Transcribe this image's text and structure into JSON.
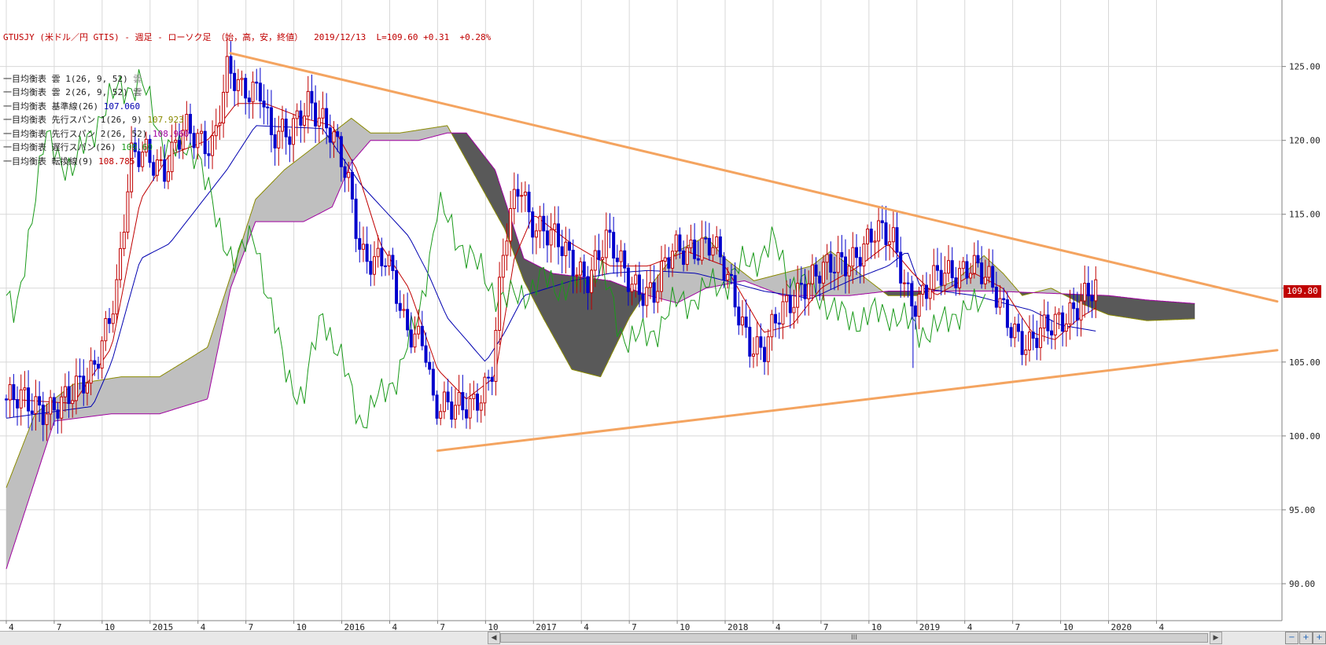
{
  "header": {
    "title": "GTUSJY (米ドル／円 GTIS) - 週足 - ローソク足 （始，高，安，終値）",
    "quote": "2019/12/13  L=109.60 +0.31  +0.28%"
  },
  "legend": [
    {
      "name": "一目均衡表 雲 1(26, 9, 52)",
      "value": "雲",
      "color": "#888888"
    },
    {
      "name": "一目均衡表 雲 2(26, 9, 52)",
      "value": "雲",
      "color": "#555555"
    },
    {
      "name": "一目均衡表 基準線(26)",
      "value": "107.060",
      "color": "#0000b0"
    },
    {
      "name": "一目均衡表 先行スパン 1(26, 9)",
      "value": "107.923",
      "color": "#8a8a00"
    },
    {
      "name": "一目均衡表 先行スパン 2(26, 52)",
      "value": "108.960",
      "color": "#a000a0"
    },
    {
      "name": "一目均衡表 遅行スパン(26)",
      "value": "109.60",
      "color": "#1a9a1a"
    },
    {
      "name": "一目均衡表 転換線(9)",
      "value": "108.785",
      "color": "#c00000"
    }
  ],
  "price_tag": {
    "label": "109.80",
    "value": 109.8,
    "bg": "#c00000"
  },
  "scrollbar": {
    "left_arrow": "◀",
    "right_arrow": "▶",
    "thumb": "III",
    "zoom_out": "−",
    "zoom_in": "+"
  },
  "colors": {
    "up": "#c00000",
    "down": "#0000cc",
    "kijun": "#0000b0",
    "tenkan": "#c00000",
    "chikou": "#1a9a1a",
    "cloud_up": "#bfbfbf",
    "cloud_down": "#595959",
    "span1": "#8a8a00",
    "span2": "#a000a0",
    "trend": "#f4a460",
    "grid": "#d8d8d8"
  },
  "chart_data": {
    "type": "candlestick",
    "ylim": [
      87.5,
      129.5
    ],
    "yticks": [
      90,
      95,
      100,
      105,
      110,
      115,
      120,
      125
    ],
    "ytick_labels": [
      "90.00",
      "95.00",
      "100.00",
      "105.00",
      "110.00",
      "115.00",
      "120.00",
      "125.00"
    ],
    "xlim": [
      2014.25,
      2020.88
    ],
    "xticks": [
      {
        "x": 2014.25,
        "label": "4"
      },
      {
        "x": 2014.5,
        "label": "7"
      },
      {
        "x": 2014.75,
        "label": "10"
      },
      {
        "x": 2015.0,
        "label": "2015"
      },
      {
        "x": 2015.25,
        "label": "4"
      },
      {
        "x": 2015.5,
        "label": "7"
      },
      {
        "x": 2015.75,
        "label": "10"
      },
      {
        "x": 2016.0,
        "label": "2016"
      },
      {
        "x": 2016.25,
        "label": "4"
      },
      {
        "x": 2016.5,
        "label": "7"
      },
      {
        "x": 2016.75,
        "label": "10"
      },
      {
        "x": 2017.0,
        "label": "2017"
      },
      {
        "x": 2017.25,
        "label": "4"
      },
      {
        "x": 2017.5,
        "label": "7"
      },
      {
        "x": 2017.75,
        "label": "10"
      },
      {
        "x": 2018.0,
        "label": "2018"
      },
      {
        "x": 2018.25,
        "label": "4"
      },
      {
        "x": 2018.5,
        "label": "7"
      },
      {
        "x": 2018.75,
        "label": "10"
      },
      {
        "x": 2019.0,
        "label": "2019"
      },
      {
        "x": 2019.25,
        "label": "4"
      },
      {
        "x": 2019.5,
        "label": "7"
      },
      {
        "x": 2019.75,
        "label": "10"
      },
      {
        "x": 2020.0,
        "label": "2020"
      },
      {
        "x": 2020.25,
        "label": "4"
      }
    ],
    "price_anchors": [
      [
        2014.25,
        102.5
      ],
      [
        2014.4,
        102.0
      ],
      [
        2014.6,
        102.3
      ],
      [
        2014.7,
        104.0
      ],
      [
        2014.85,
        110.0
      ],
      [
        2014.92,
        118.5
      ],
      [
        2015.0,
        119.5
      ],
      [
        2015.1,
        118.0
      ],
      [
        2015.2,
        120.5
      ],
      [
        2015.35,
        120.0
      ],
      [
        2015.42,
        124.5
      ],
      [
        2015.5,
        123.0
      ],
      [
        2015.6,
        124.0
      ],
      [
        2015.65,
        120.5
      ],
      [
        2015.75,
        120.0
      ],
      [
        2015.85,
        123.0
      ],
      [
        2015.95,
        121.0
      ],
      [
        2016.05,
        117.0
      ],
      [
        2016.12,
        112.5
      ],
      [
        2016.25,
        112.0
      ],
      [
        2016.35,
        107.0
      ],
      [
        2016.45,
        107.0
      ],
      [
        2016.5,
        102.0
      ],
      [
        2016.6,
        101.5
      ],
      [
        2016.7,
        102.5
      ],
      [
        2016.8,
        104.0
      ],
      [
        2016.87,
        113.0
      ],
      [
        2016.95,
        117.5
      ],
      [
        2017.0,
        115.0
      ],
      [
        2017.2,
        112.0
      ],
      [
        2017.3,
        111.0
      ],
      [
        2017.4,
        113.0
      ],
      [
        2017.5,
        111.0
      ],
      [
        2017.65,
        109.5
      ],
      [
        2017.75,
        112.5
      ],
      [
        2017.85,
        113.0
      ],
      [
        2017.95,
        112.8
      ],
      [
        2018.05,
        110.0
      ],
      [
        2018.15,
        106.5
      ],
      [
        2018.22,
        105.5
      ],
      [
        2018.3,
        108.0
      ],
      [
        2018.42,
        110.5
      ],
      [
        2018.55,
        111.0
      ],
      [
        2018.7,
        112.5
      ],
      [
        2018.8,
        113.5
      ],
      [
        2018.9,
        113.2
      ],
      [
        2018.97,
        110.0
      ],
      [
        2019.02,
        109.0
      ],
      [
        2019.15,
        110.8
      ],
      [
        2019.3,
        111.8
      ],
      [
        2019.4,
        110.0
      ],
      [
        2019.5,
        108.0
      ],
      [
        2019.6,
        106.0
      ],
      [
        2019.68,
        106.8
      ],
      [
        2019.8,
        108.5
      ],
      [
        2019.88,
        109.2
      ],
      [
        2019.95,
        109.6
      ]
    ],
    "kijun_anchors": [
      [
        2014.25,
        101.2
      ],
      [
        2014.7,
        102.0
      ],
      [
        2014.8,
        105.0
      ],
      [
        2014.95,
        112.0
      ],
      [
        2015.1,
        113.0
      ],
      [
        2015.4,
        118.0
      ],
      [
        2015.55,
        121.0
      ],
      [
        2015.9,
        120.8
      ],
      [
        2016.1,
        117.0
      ],
      [
        2016.35,
        113.5
      ],
      [
        2016.45,
        111.0
      ],
      [
        2016.55,
        108.0
      ],
      [
        2016.75,
        105.0
      ],
      [
        2016.85,
        107.0
      ],
      [
        2016.95,
        109.5
      ],
      [
        2017.2,
        110.5
      ],
      [
        2017.4,
        111.0
      ],
      [
        2017.6,
        111.2
      ],
      [
        2017.85,
        111.0
      ],
      [
        2018.0,
        110.5
      ],
      [
        2018.2,
        109.8
      ],
      [
        2018.45,
        109.3
      ],
      [
        2018.65,
        110.5
      ],
      [
        2018.85,
        111.5
      ],
      [
        2018.95,
        112.5
      ],
      [
        2019.02,
        110.0
      ],
      [
        2019.3,
        109.5
      ],
      [
        2019.45,
        109.0
      ],
      [
        2019.6,
        108.5
      ],
      [
        2019.75,
        107.5
      ],
      [
        2019.95,
        107.06
      ]
    ],
    "tenkan_anchors": [
      [
        2014.25,
        102.5
      ],
      [
        2014.6,
        102.2
      ],
      [
        2014.8,
        106.0
      ],
      [
        2014.95,
        116.0
      ],
      [
        2015.1,
        119.0
      ],
      [
        2015.3,
        120.0
      ],
      [
        2015.45,
        122.5
      ],
      [
        2015.6,
        122.5
      ],
      [
        2015.8,
        121.5
      ],
      [
        2015.95,
        121.0
      ],
      [
        2016.08,
        118.0
      ],
      [
        2016.2,
        113.0
      ],
      [
        2016.35,
        110.0
      ],
      [
        2016.5,
        104.5
      ],
      [
        2016.65,
        102.5
      ],
      [
        2016.8,
        104.0
      ],
      [
        2016.9,
        112.0
      ],
      [
        2017.0,
        115.0
      ],
      [
        2017.2,
        113.0
      ],
      [
        2017.4,
        111.5
      ],
      [
        2017.6,
        111.5
      ],
      [
        2017.8,
        112.5
      ],
      [
        2018.0,
        111.5
      ],
      [
        2018.2,
        107.0
      ],
      [
        2018.35,
        107.5
      ],
      [
        2018.5,
        110.0
      ],
      [
        2018.7,
        111.5
      ],
      [
        2018.85,
        113.0
      ],
      [
        2018.98,
        111.0
      ],
      [
        2019.1,
        109.5
      ],
      [
        2019.3,
        111.0
      ],
      [
        2019.45,
        110.0
      ],
      [
        2019.6,
        107.0
      ],
      [
        2019.72,
        106.5
      ],
      [
        2019.85,
        108.0
      ],
      [
        2019.95,
        108.785
      ]
    ],
    "span1_anchors": [
      [
        2014.25,
        96.5
      ],
      [
        2014.4,
        101.5
      ],
      [
        2014.6,
        103.5
      ],
      [
        2014.85,
        104.0
      ],
      [
        2015.05,
        104.0
      ],
      [
        2015.3,
        106.0
      ],
      [
        2015.45,
        112.0
      ],
      [
        2015.55,
        116.0
      ],
      [
        2015.7,
        118.0
      ],
      [
        2015.9,
        120.0
      ],
      [
        2016.05,
        121.5
      ],
      [
        2016.15,
        120.5
      ],
      [
        2016.3,
        120.5
      ],
      [
        2016.55,
        121.0
      ],
      [
        2016.7,
        117.5
      ],
      [
        2016.85,
        114.0
      ],
      [
        2016.95,
        110.5
      ],
      [
        2017.05,
        108.0
      ],
      [
        2017.2,
        104.5
      ],
      [
        2017.35,
        104.0
      ],
      [
        2017.5,
        108.0
      ],
      [
        2017.6,
        110.0
      ],
      [
        2017.75,
        112.5
      ],
      [
        2017.9,
        113.5
      ],
      [
        2018.0,
        112.0
      ],
      [
        2018.15,
        110.5
      ],
      [
        2018.3,
        111.0
      ],
      [
        2018.45,
        111.5
      ],
      [
        2018.55,
        112.5
      ],
      [
        2018.7,
        111.0
      ],
      [
        2018.85,
        109.5
      ],
      [
        2019.0,
        109.5
      ],
      [
        2019.2,
        110.5
      ],
      [
        2019.35,
        112.2
      ],
      [
        2019.45,
        111.0
      ],
      [
        2019.55,
        109.5
      ],
      [
        2019.7,
        110.0
      ],
      [
        2019.85,
        109.0
      ],
      [
        2020.0,
        108.2
      ],
      [
        2020.2,
        107.8
      ],
      [
        2020.45,
        107.923
      ]
    ],
    "span2_anchors": [
      [
        2014.25,
        91.0
      ],
      [
        2014.4,
        97.0
      ],
      [
        2014.5,
        101.0
      ],
      [
        2014.8,
        101.5
      ],
      [
        2015.05,
        101.5
      ],
      [
        2015.3,
        102.5
      ],
      [
        2015.42,
        110.0
      ],
      [
        2015.55,
        114.5
      ],
      [
        2015.8,
        114.5
      ],
      [
        2015.95,
        115.5
      ],
      [
        2016.05,
        118.5
      ],
      [
        2016.15,
        120.0
      ],
      [
        2016.4,
        120.0
      ],
      [
        2016.55,
        120.5
      ],
      [
        2016.65,
        120.5
      ],
      [
        2016.8,
        118.0
      ],
      [
        2016.95,
        112.0
      ],
      [
        2017.1,
        111.0
      ],
      [
        2017.4,
        110.5
      ],
      [
        2017.6,
        109.5
      ],
      [
        2017.75,
        109.0
      ],
      [
        2017.9,
        110.0
      ],
      [
        2018.1,
        110.5
      ],
      [
        2018.3,
        109.5
      ],
      [
        2018.5,
        109.5
      ],
      [
        2018.65,
        109.5
      ],
      [
        2018.85,
        109.8
      ],
      [
        2019.0,
        109.8
      ],
      [
        2019.2,
        109.8
      ],
      [
        2019.4,
        109.8
      ],
      [
        2019.6,
        109.7
      ],
      [
        2019.8,
        109.6
      ],
      [
        2020.0,
        109.5
      ],
      [
        2020.2,
        109.2
      ],
      [
        2020.45,
        108.96
      ]
    ],
    "chikou_anchors": [
      [
        2014.25,
        109.5
      ],
      [
        2014.3,
        107.5
      ],
      [
        2014.38,
        115.0
      ],
      [
        2014.45,
        120.0
      ],
      [
        2014.6,
        118.0
      ],
      [
        2014.75,
        122.0
      ],
      [
        2014.85,
        123.5
      ],
      [
        2014.95,
        124.0
      ],
      [
        2015.05,
        120.5
      ],
      [
        2015.15,
        119.0
      ],
      [
        2015.25,
        119.5
      ],
      [
        2015.35,
        114.0
      ],
      [
        2015.45,
        112.0
      ],
      [
        2015.55,
        113.5
      ],
      [
        2015.7,
        104.5
      ],
      [
        2015.8,
        102.5
      ],
      [
        2015.9,
        108.5
      ],
      [
        2016.05,
        103.0
      ],
      [
        2016.1,
        101.0
      ],
      [
        2016.2,
        102.5
      ],
      [
        2016.3,
        104.5
      ],
      [
        2016.4,
        108.0
      ],
      [
        2016.5,
        115.5
      ],
      [
        2016.6,
        113.5
      ],
      [
        2016.7,
        111.5
      ],
      [
        2016.85,
        109.0
      ],
      [
        2017.05,
        110.5
      ],
      [
        2017.2,
        110.0
      ],
      [
        2017.35,
        111.5
      ],
      [
        2017.45,
        107.0
      ],
      [
        2017.6,
        106.5
      ],
      [
        2017.7,
        108.5
      ],
      [
        2017.85,
        109.5
      ],
      [
        2018.0,
        110.5
      ],
      [
        2018.15,
        112.0
      ],
      [
        2018.25,
        113.0
      ],
      [
        2018.35,
        110.5
      ],
      [
        2018.5,
        109.5
      ],
      [
        2018.6,
        108.0
      ],
      [
        2018.75,
        108.0
      ],
      [
        2018.85,
        108.5
      ],
      [
        2018.95,
        107.5
      ],
      [
        2019.1,
        107.0
      ],
      [
        2019.2,
        108.5
      ],
      [
        2019.3,
        108.5
      ],
      [
        2019.37,
        109.6
      ]
    ],
    "trendlines": [
      {
        "from": [
          2015.42,
          125.9
        ],
        "to": [
          2020.88,
          109.1
        ]
      },
      {
        "from": [
          2016.5,
          99.0
        ],
        "to": [
          2020.88,
          105.8
        ]
      }
    ],
    "lowest_wick": {
      "x": 2018.98,
      "low": 104.6,
      "high": 110.5
    }
  }
}
